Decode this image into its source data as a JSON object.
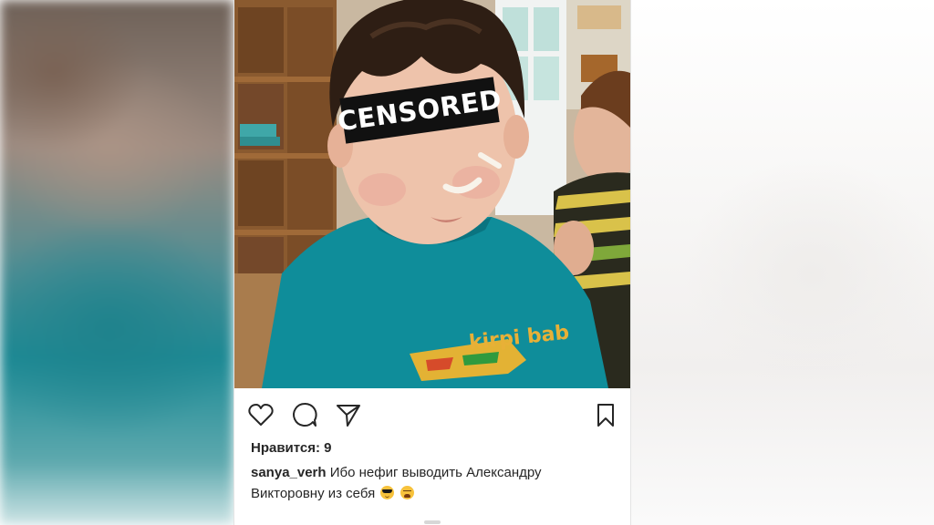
{
  "photo": {
    "censor_label": "CENSORED",
    "shirt_text": "kirpi bab"
  },
  "actions": {
    "like_icon": "heart-icon",
    "comment_icon": "comment-icon",
    "share_icon": "send-icon",
    "save_icon": "bookmark-icon"
  },
  "likes": {
    "text": "Нравится: 9"
  },
  "caption": {
    "username": "sanya_verh",
    "text": "Ибо нефиг выводить Александру Викторовну из себя",
    "emojis": [
      "smiling-face-with-sunglasses-icon",
      "crying-face-icon"
    ]
  },
  "colors": {
    "shirt": "#0f8d9a",
    "text": "#262626",
    "censor_bar": "#111111"
  }
}
